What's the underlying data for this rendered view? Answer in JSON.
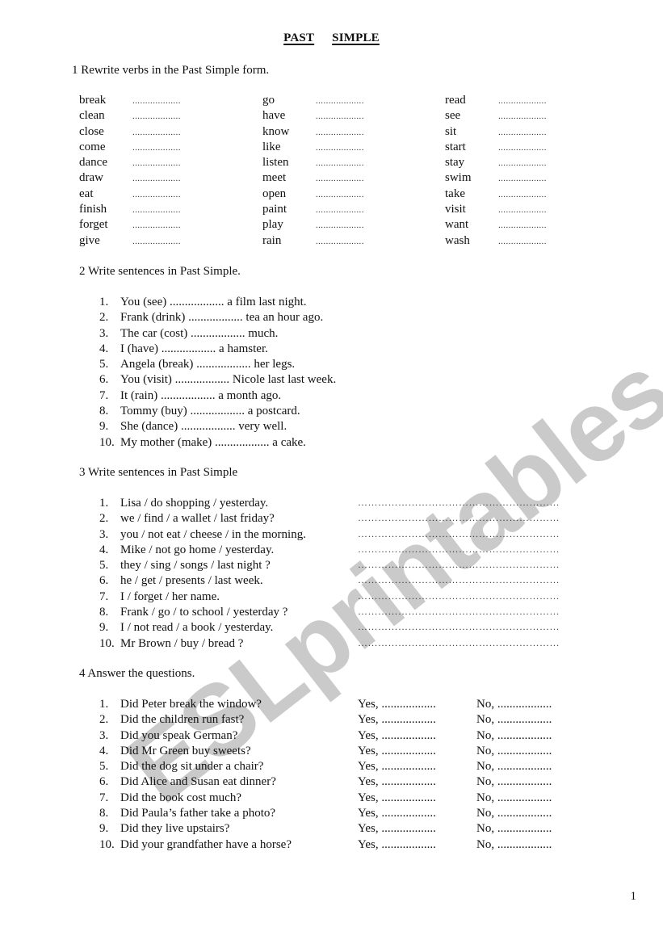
{
  "title": {
    "word1": "PAST",
    "word2": "SIMPLE"
  },
  "section1": {
    "heading": "1 Rewrite verbs in the Past Simple form.",
    "blank": "...................",
    "columns": [
      [
        "break",
        "clean",
        "close",
        "come",
        "dance",
        "draw",
        "eat",
        "finish",
        "forget",
        "give"
      ],
      [
        "go",
        "have",
        "know",
        "like",
        "listen",
        "meet",
        "open",
        "paint",
        "play",
        "rain"
      ],
      [
        "read",
        "see",
        "sit",
        "start",
        "stay",
        "swim",
        "take",
        "visit",
        "want",
        "wash"
      ]
    ]
  },
  "section2": {
    "heading": "2 Write sentences in Past Simple.",
    "items": [
      {
        "num": "1.",
        "text": "You (see) .................. a film last night."
      },
      {
        "num": "2.",
        "text": "Frank (drink) .................. tea an hour ago."
      },
      {
        "num": "3.",
        "text": "The car (cost) .................. much."
      },
      {
        "num": "4.",
        "text": "I (have) .................. a hamster."
      },
      {
        "num": "5.",
        "text": "Angela (break) .................. her legs."
      },
      {
        "num": "6.",
        "text": "You (visit) .................. Nicole last last week."
      },
      {
        "num": "7.",
        "text": "It (rain) .................. a month ago."
      },
      {
        "num": "8.",
        "text": "Tommy (buy) .................. a postcard."
      },
      {
        "num": "9.",
        "text": "She (dance) .................. very well."
      },
      {
        "num": "10.",
        "text": "My mother (make) .................. a cake."
      }
    ]
  },
  "section3": {
    "heading": "3 Write sentences in Past Simple",
    "answer_line": "……………………………………………………",
    "items": [
      {
        "num": "1.",
        "text": "Lisa / do shopping / yesterday."
      },
      {
        "num": "2.",
        "text": "we / find / a wallet / last friday?"
      },
      {
        "num": "3.",
        "text": "you / not eat / cheese / in the morning."
      },
      {
        "num": "4.",
        "text": "Mike / not go home / yesterday."
      },
      {
        "num": "5.",
        "text": "they / sing / songs / last night ?"
      },
      {
        "num": "6.",
        "text": "he / get / presents / last week."
      },
      {
        "num": "7.",
        "text": "I / forget / her name."
      },
      {
        "num": "8.",
        "text": "Frank / go / to school / yesterday ?"
      },
      {
        "num": "9.",
        "text": "I / not read / a book / yesterday."
      },
      {
        "num": "10.",
        "text": "Mr Brown / buy / bread ?"
      }
    ]
  },
  "section4": {
    "heading": "4 Answer the questions.",
    "yes_label": "Yes, ..................",
    "no_label": "No, ..................",
    "items": [
      {
        "num": "1.",
        "text": "Did Peter break the window?"
      },
      {
        "num": "2.",
        "text": "Did the children run fast?"
      },
      {
        "num": "3.",
        "text": "Did you speak German?"
      },
      {
        "num": "4.",
        "text": "Did Mr Green buy sweets?"
      },
      {
        "num": "5.",
        "text": "Did the dog sit under a chair?"
      },
      {
        "num": "6.",
        "text": "Did Alice and Susan eat dinner?"
      },
      {
        "num": "7.",
        "text": "Did the book cost much?"
      },
      {
        "num": "8.",
        "text": "Did Paula’s father take a photo?"
      },
      {
        "num": "9.",
        "text": "Did they live upstairs?"
      },
      {
        "num": "10.",
        "text": "Did your grandfather have a horse?"
      }
    ]
  },
  "page_number": "1",
  "watermark": "ESLprintables.com"
}
